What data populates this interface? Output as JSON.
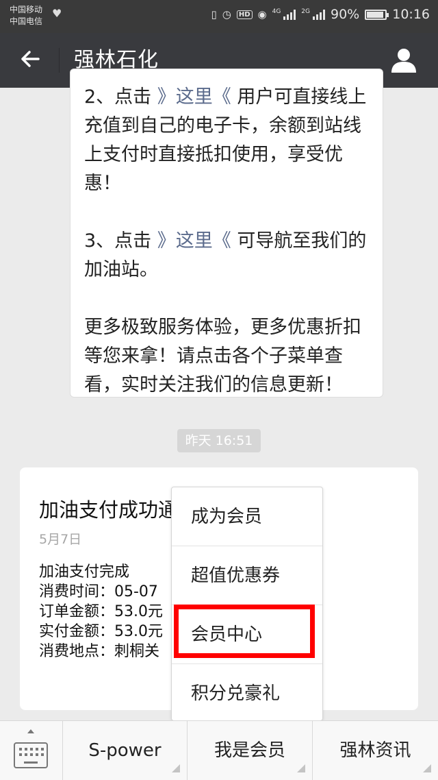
{
  "status_bar": {
    "carrier1": "中国移动",
    "carrier2": "中国电信",
    "net1": "4G",
    "net2": "2G",
    "battery_percent": "90%",
    "battery_level": 0.9,
    "time": "10:16",
    "hd": "HD"
  },
  "header": {
    "title": "强林石化"
  },
  "message": {
    "item2_prefix": "2、点击 ",
    "item2_link": "》这里《",
    "item2_text": " 用户可直接线上充值到自己的电子卡，余额到站线上支付时直接抵扣使用，享受优惠！",
    "item3_prefix": "3、点击 ",
    "item3_link": "》这里《",
    "item3_text": " 可导航至我们的加油站。",
    "closing": "更多极致服务体验，更多优惠折扣等您来拿！请点击各个子菜单查看，实时关注我们的信息更新！"
  },
  "timestamp": "昨天 16:51",
  "card": {
    "title": "加油支付成功通",
    "date": "5月7日",
    "line1": "加油支付完成",
    "line2": "消费时间：05-07",
    "line3": "订单金额：53.0元",
    "line4": "实付金额：53.0元",
    "line5": "消费地点：刺桐关"
  },
  "popup": {
    "items": [
      "成为会员",
      "超值优惠券",
      "会员中心",
      "积分兑豪礼"
    ],
    "highlighted": "会员中心"
  },
  "bottom_menu": {
    "items": [
      "S-power",
      "我是会员",
      "强林资讯"
    ]
  },
  "colors": {
    "header_bg": "#393a3e",
    "link": "#5b6b8c",
    "highlight": "#ff0000"
  }
}
